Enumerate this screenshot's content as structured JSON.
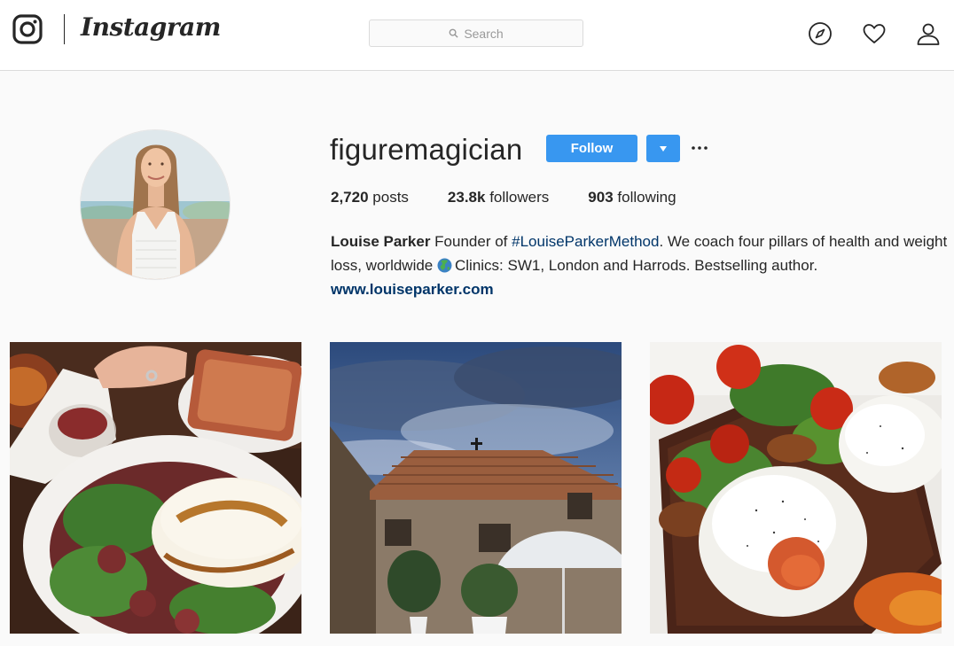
{
  "nav": {
    "logo_glyph": "instagram-camera-icon",
    "wordmark": "Instagram",
    "search_placeholder": "Search",
    "icons": [
      "compass-icon",
      "heart-icon",
      "person-icon"
    ]
  },
  "profile": {
    "username": "figuremagician",
    "follow_label": "Follow",
    "stats": {
      "posts_value": "2,720",
      "posts_label": "posts",
      "followers_value": "23.8k",
      "followers_label": "followers",
      "following_value": "903",
      "following_label": "following"
    },
    "bio": {
      "name": "Louise Parker",
      "text_1": " Founder of ",
      "hashtag": "#LouiseParkerMethod",
      "text_2": ". We coach four pillars of health and weight loss, worldwide ",
      "text_3": "Clinics: SW1, London and Harrods. Bestselling author.",
      "website": "www.louiseparker.com"
    }
  },
  "colors": {
    "accent": "#3897f0",
    "link": "#003569",
    "background": "#fafafa"
  }
}
